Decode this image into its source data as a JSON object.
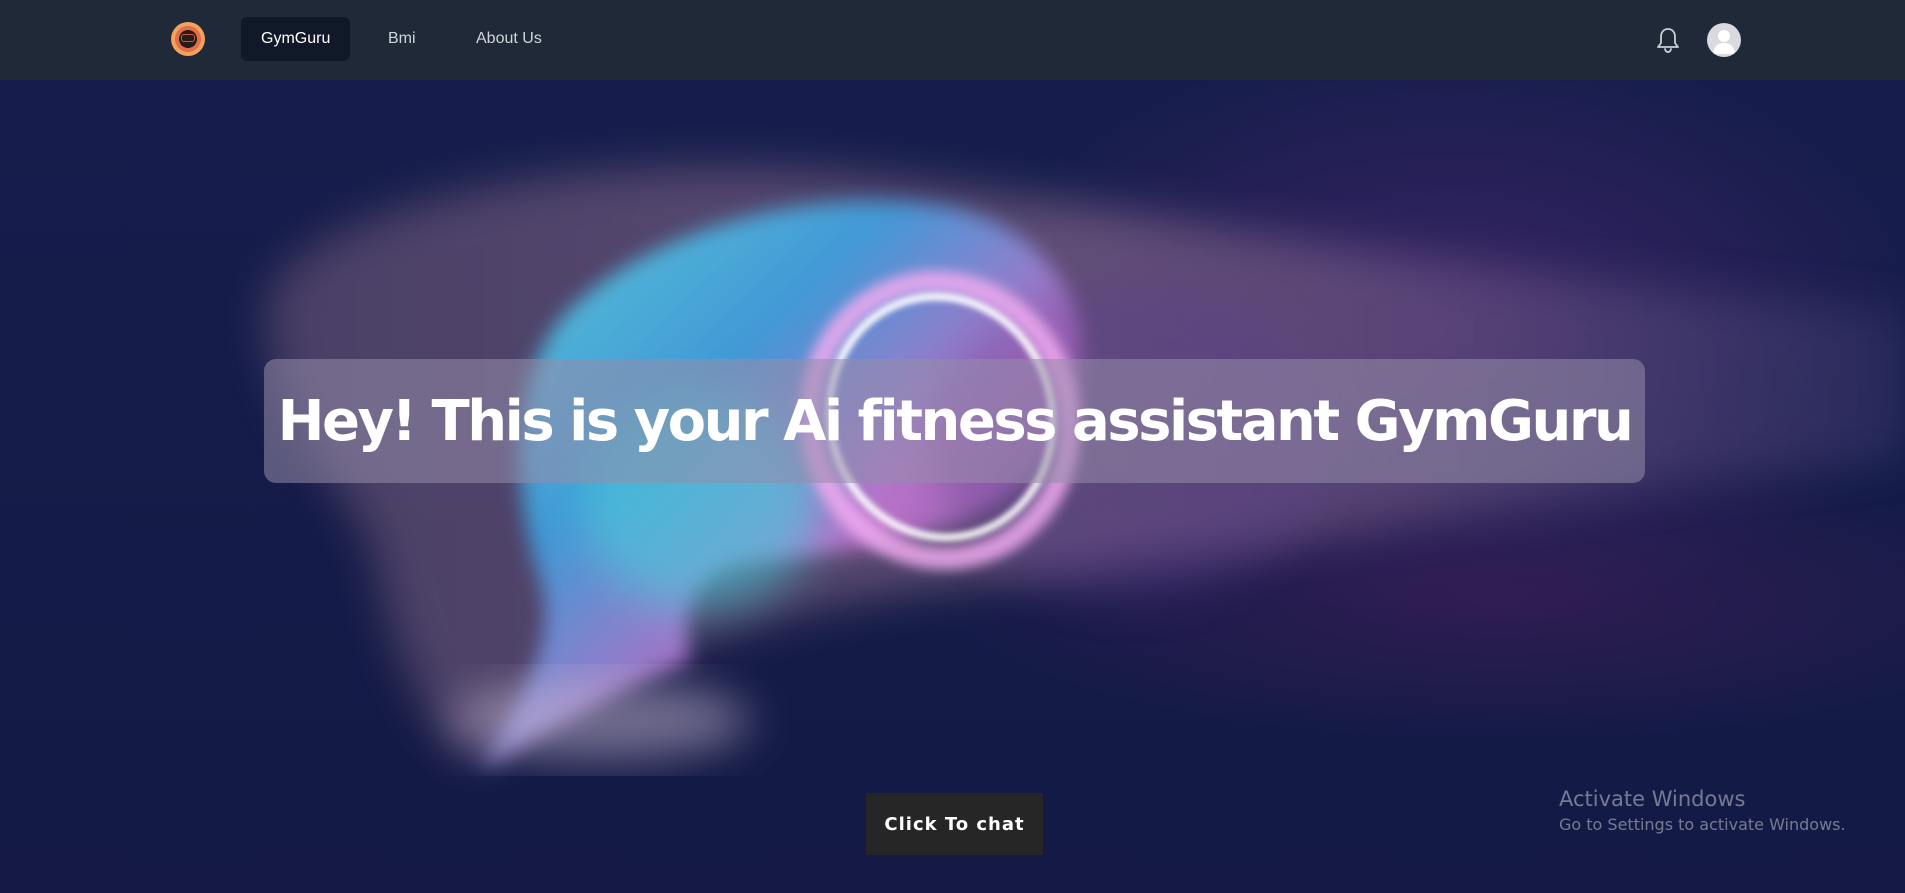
{
  "nav": {
    "logo_icon": "gymguru-logo-icon",
    "items": [
      {
        "label": "GymGuru",
        "active": true
      },
      {
        "label": "Bmi",
        "active": false
      },
      {
        "label": "About Us",
        "active": false
      }
    ],
    "notification_icon": "bell-icon",
    "avatar_icon": "user-avatar-icon"
  },
  "hero": {
    "headline": "Hey! This is your Ai fitness assistant GymGuru",
    "cta_label": "Click To chat"
  },
  "watermark": {
    "title": "Activate Windows",
    "subtitle": "Go to Settings to activate Windows."
  },
  "colors": {
    "navbar_bg": "#1f2937",
    "active_nav_bg": "#111827",
    "page_bg": "#141a45",
    "button_bg": "#262626"
  }
}
